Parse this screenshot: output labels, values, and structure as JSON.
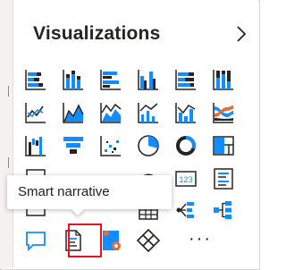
{
  "pane": {
    "title": "Visualizations",
    "collapse_icon": "chevron-right-icon"
  },
  "visuals": [
    {
      "name": "stacked-bar-chart-icon"
    },
    {
      "name": "stacked-column-chart-icon"
    },
    {
      "name": "clustered-bar-chart-icon"
    },
    {
      "name": "clustered-column-chart-icon"
    },
    {
      "name": "100-stacked-bar-chart-icon"
    },
    {
      "name": "100-stacked-column-chart-icon"
    },
    {
      "name": "line-chart-icon"
    },
    {
      "name": "area-chart-icon"
    },
    {
      "name": "stacked-area-chart-icon"
    },
    {
      "name": "line-clustered-column-chart-icon"
    },
    {
      "name": "line-stacked-column-chart-icon"
    },
    {
      "name": "ribbon-chart-icon"
    },
    {
      "name": "waterfall-chart-icon"
    },
    {
      "name": "funnel-chart-icon"
    },
    {
      "name": "scatter-chart-icon"
    },
    {
      "name": "pie-chart-icon"
    },
    {
      "name": "donut-chart-icon"
    },
    {
      "name": "treemap-icon"
    },
    {
      "name": "gauge-icon"
    },
    {
      "name": "card-icon"
    },
    {
      "name": "multi-row-card-icon"
    },
    {
      "name": "kpi-icon"
    },
    {
      "name": "slicer-icon"
    },
    {
      "name": "table-icon"
    },
    {
      "name": "matrix-icon"
    },
    {
      "name": "key-influencers-icon"
    },
    {
      "name": "decomposition-tree-icon"
    },
    {
      "name": "qa-icon"
    },
    {
      "name": "smart-narrative-icon"
    },
    {
      "name": "paginated-report-icon"
    },
    {
      "name": "power-apps-icon"
    },
    {
      "name": "more-visuals-icon"
    }
  ],
  "card_icon_text": "123",
  "tooltip": {
    "text": "Smart narrative"
  },
  "more_label": "···",
  "colors": {
    "blue": "#118dff",
    "dark": "#252423",
    "orange": "#e66c37",
    "highlight": "#e81123"
  }
}
